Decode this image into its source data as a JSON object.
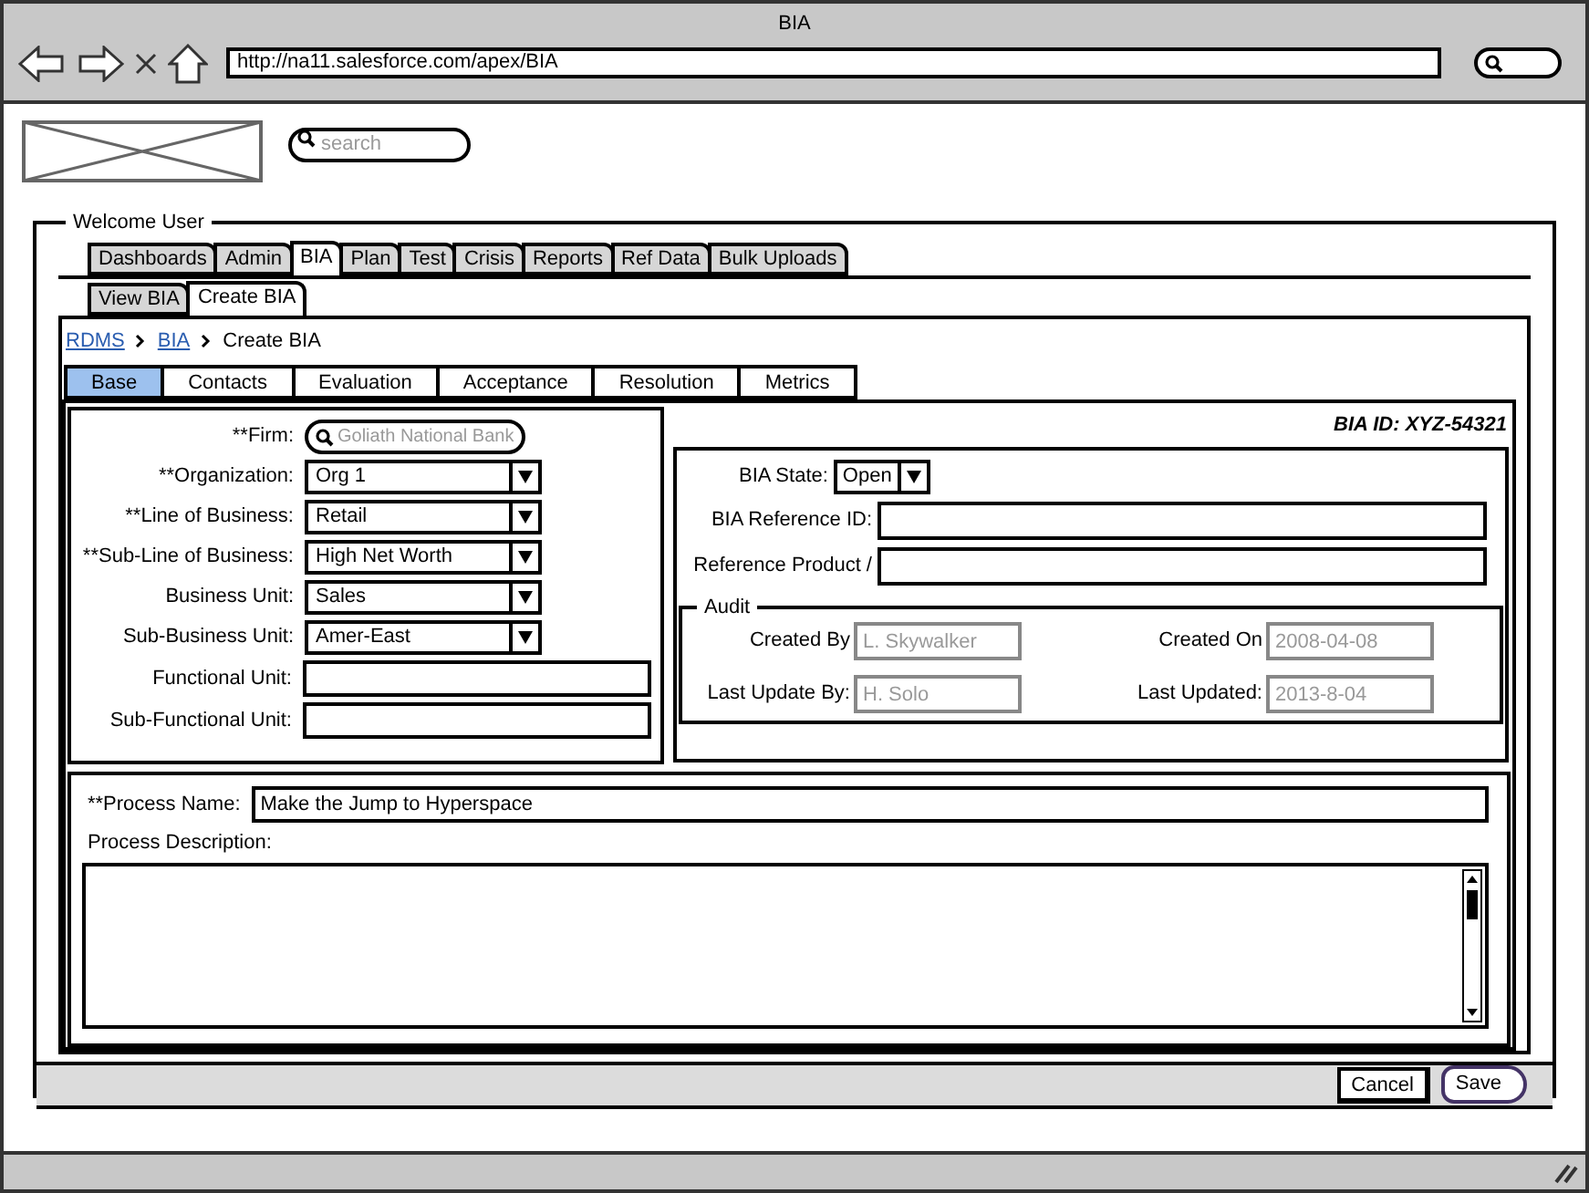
{
  "window": {
    "title": "BIA"
  },
  "address_bar": {
    "url": "http://na11.salesforce.com/apex/BIA"
  },
  "header": {
    "search": {
      "placeholder": "search"
    }
  },
  "group": {
    "title": "Welcome User"
  },
  "main_tabs": [
    {
      "label": "Dashboards",
      "selected": false
    },
    {
      "label": "Admin",
      "selected": false
    },
    {
      "label": "BIA",
      "selected": true
    },
    {
      "label": "Plan",
      "selected": false
    },
    {
      "label": "Test",
      "selected": false
    },
    {
      "label": "Crisis",
      "selected": false
    },
    {
      "label": "Reports",
      "selected": false
    },
    {
      "label": "Ref Data",
      "selected": false
    },
    {
      "label": "Bulk Uploads",
      "selected": false
    }
  ],
  "sub_tabs": [
    {
      "label": "View BIA",
      "selected": false
    },
    {
      "label": "Create BIA",
      "selected": true
    }
  ],
  "breadcrumb": [
    {
      "label": "RDMS",
      "kind": "link"
    },
    {
      "label": "BIA",
      "kind": "link"
    },
    {
      "label": "Create BIA",
      "kind": "text"
    }
  ],
  "form_tabs": [
    {
      "label": "Base",
      "selected": true
    },
    {
      "label": "Contacts",
      "selected": false
    },
    {
      "label": "Evaluation",
      "selected": false
    },
    {
      "label": "Acceptance",
      "selected": false
    },
    {
      "label": "Resolution",
      "selected": false
    },
    {
      "label": "Metrics",
      "selected": false
    }
  ],
  "left_fields": [
    {
      "label": "**Firm:",
      "kind": "search",
      "placeholder": "Goliath National Bank"
    },
    {
      "label": "**Organization:",
      "kind": "select",
      "value": "Org 1"
    },
    {
      "label": "**Line of Business:",
      "kind": "select",
      "value": "Retail"
    },
    {
      "label": "**Sub-Line of Business:",
      "kind": "select",
      "value": "High Net Worth"
    },
    {
      "label": "Business Unit:",
      "kind": "select",
      "value": "Sales"
    },
    {
      "label": "Sub-Business Unit:",
      "kind": "select",
      "value": "Amer-East"
    },
    {
      "label": "Functional Unit:",
      "kind": "text"
    },
    {
      "label": "Sub-Functional Unit:",
      "kind": "text"
    }
  ],
  "bia_id": "BIA ID: XYZ-54321",
  "bia_state": {
    "label": "BIA State:",
    "value": "Open"
  },
  "right_fields": [
    {
      "label": "BIA Reference ID:"
    },
    {
      "label": "Reference Product /"
    }
  ],
  "audit": {
    "title": "Audit",
    "fields": [
      {
        "label": "Created By",
        "value": "L. Skywalker",
        "disabled": true
      },
      {
        "label": "Created On",
        "value": "2008-04-08",
        "disabled": true
      },
      {
        "label": "Last Update By:",
        "value": "H. Solo",
        "disabled": true
      },
      {
        "label": "Last Updated:",
        "value": "2013-8-04",
        "disabled": true
      }
    ]
  },
  "process": {
    "name_label": "**Process Name:",
    "name_value": "Make the Jump to Hyperspace",
    "description_label": "Process Description:"
  },
  "buttons": [
    {
      "label": "Cancel",
      "kind": "plain"
    },
    {
      "label": "Save",
      "kind": "arrow"
    }
  ]
}
